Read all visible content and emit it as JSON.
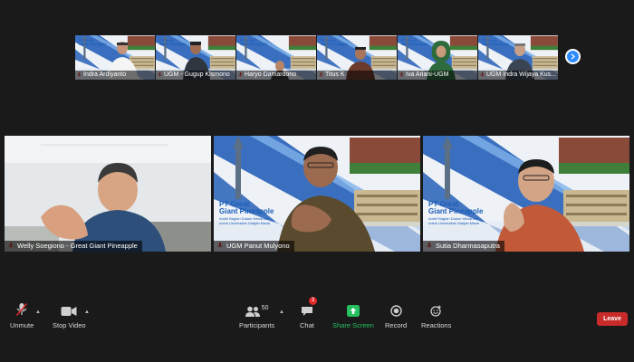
{
  "thumbnails": [
    {
      "name": "Indra Ardiyanto"
    },
    {
      "name": "UGM - Gugup Kismono"
    },
    {
      "name": "Haryo Damardono"
    },
    {
      "name": "Titus K"
    },
    {
      "name": "Iva Ariani-UGM"
    },
    {
      "name": "UGM Indra Wijaya Kus..."
    }
  ],
  "tiles": [
    {
      "name": "Welly Soegiono - Great Giant Pineapple"
    },
    {
      "name": "UGM Panut Mulyono"
    },
    {
      "name": "Sutia Dharmasaputra"
    }
  ],
  "background": {
    "brand_line1": "PT Great",
    "brand_line2": "Giant Pineapple",
    "tagline": "Ambil Bagian Dalam Menanam",
    "tagline2": "untuk Universitas Gadjah Mada",
    "thumb_brand1": "PT Great",
    "thumb_brand2": "Giant Pineapple"
  },
  "toolbar": {
    "unmute": "Unmute",
    "stop_video": "Stop Video",
    "participants": "Participants",
    "participants_count": "50",
    "chat": "Chat",
    "chat_badge": "3",
    "share_screen": "Share Screen",
    "record": "Record",
    "reactions": "Reactions",
    "leave": "Leave"
  },
  "colors": {
    "accent_blue": "#2d8cff",
    "share_green": "#26c060",
    "leave_red": "#c92a2a",
    "brand_blue": "#1d5fb8"
  }
}
